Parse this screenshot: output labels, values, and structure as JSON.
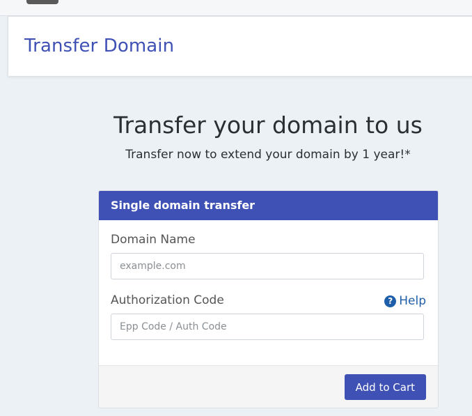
{
  "header": {
    "title": "Transfer Domain"
  },
  "hero": {
    "title": "Transfer your domain to us",
    "subtitle": "Transfer now to extend your domain by 1 year!*"
  },
  "transfer_card": {
    "header": "Single domain transfer",
    "domain_label": "Domain Name",
    "domain_value": "",
    "domain_placeholder": "example.com",
    "auth_label": "Authorization Code",
    "auth_value": "",
    "auth_placeholder": "Epp Code / Auth Code",
    "help_label": "Help",
    "help_icon": "question-circle-icon",
    "submit_label": "Add to Cart"
  },
  "colors": {
    "brand": "#3f51b5",
    "link": "#1f5ea8",
    "page_bg": "#ebf1f5"
  }
}
